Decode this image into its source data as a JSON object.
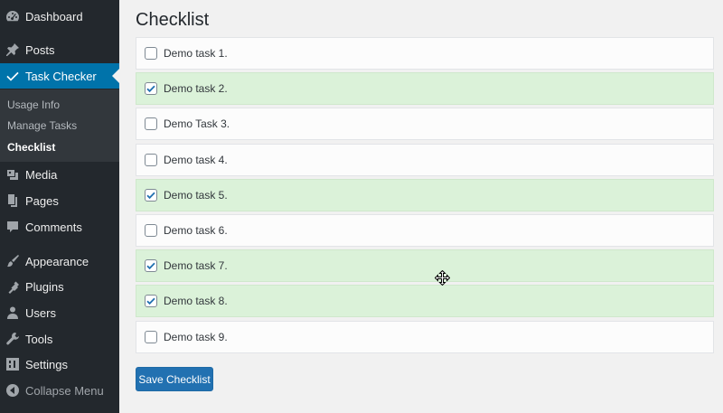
{
  "sidebar": {
    "top_items": [
      {
        "label": "Dashboard",
        "icon": "dashboard-icon"
      },
      {
        "label": "Posts",
        "icon": "pin-icon"
      },
      {
        "label": "Task Checker",
        "icon": "checkmark-icon",
        "active": true
      }
    ],
    "submenu": [
      {
        "label": "Usage Info"
      },
      {
        "label": "Manage Tasks"
      },
      {
        "label": "Checklist",
        "current": true
      }
    ],
    "bottom_items": [
      {
        "label": "Media",
        "icon": "media-icon"
      },
      {
        "label": "Pages",
        "icon": "pages-icon"
      },
      {
        "label": "Comments",
        "icon": "comment-icon"
      },
      {
        "label": "Appearance",
        "icon": "paintbrush-icon"
      },
      {
        "label": "Plugins",
        "icon": "plug-icon"
      },
      {
        "label": "Users",
        "icon": "user-icon"
      },
      {
        "label": "Tools",
        "icon": "wrench-icon"
      },
      {
        "label": "Settings",
        "icon": "settings-icon"
      },
      {
        "label": "Collapse Menu",
        "icon": "collapse-icon"
      }
    ]
  },
  "page": {
    "title": "Checklist",
    "tasks": [
      {
        "label": "Demo task 1.",
        "checked": false
      },
      {
        "label": "Demo task 2.",
        "checked": true
      },
      {
        "label": "Demo Task 3.",
        "checked": false
      },
      {
        "label": "Demo task 4.",
        "checked": false
      },
      {
        "label": "Demo task 5.",
        "checked": true
      },
      {
        "label": "Demo task 6.",
        "checked": false
      },
      {
        "label": "Demo task 7.",
        "checked": true
      },
      {
        "label": "Demo task 8.",
        "checked": true
      },
      {
        "label": "Demo task 9.",
        "checked": false
      }
    ],
    "save_label": "Save Checklist"
  },
  "colors": {
    "sidebar_bg": "#23282d",
    "active_bg": "#0073aa",
    "checked_row_bg": "#dbf2d9",
    "button_bg": "#2271b1",
    "check_color": "#2271b1"
  }
}
